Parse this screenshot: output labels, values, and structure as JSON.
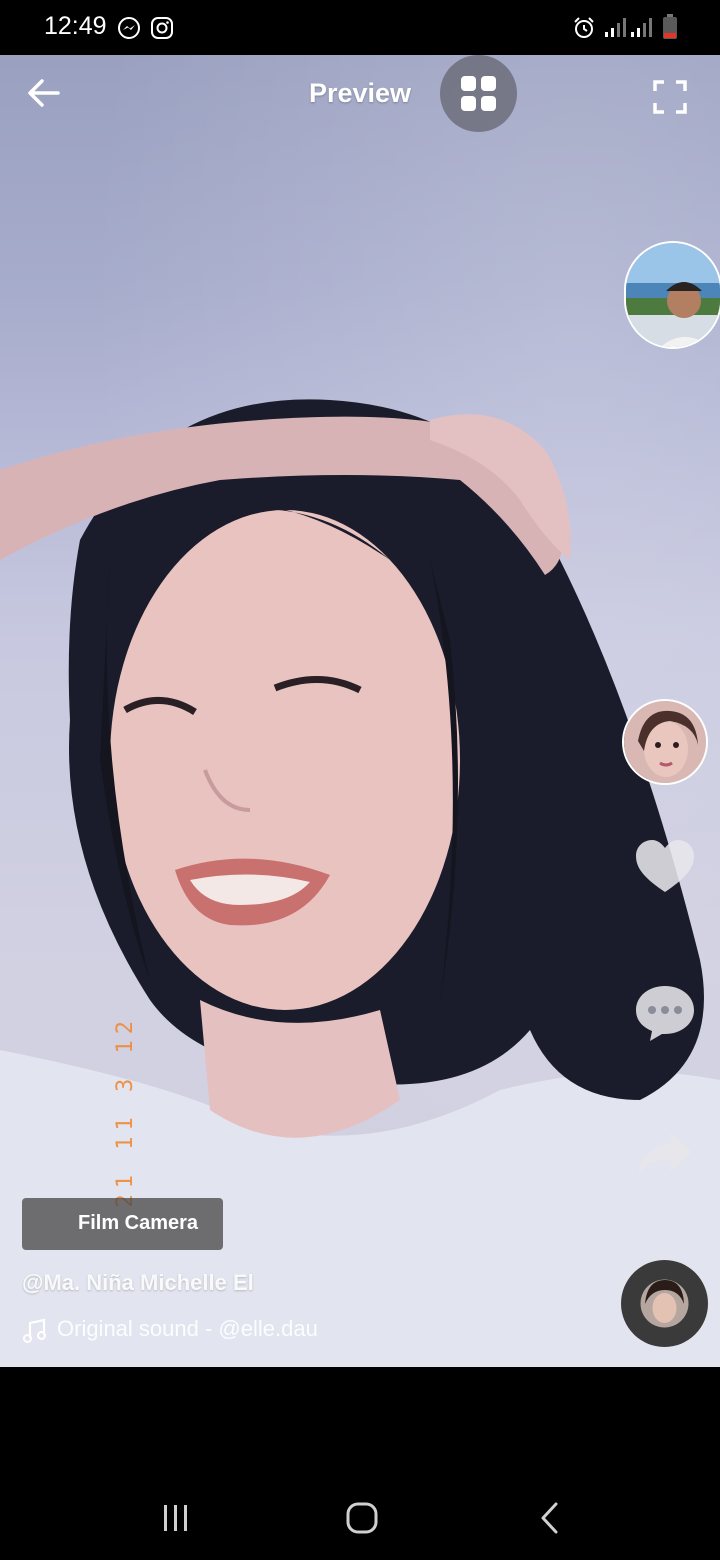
{
  "status_bar": {
    "time": "12:49",
    "icons": [
      "messenger-icon",
      "instagram-icon",
      "alarm-icon",
      "signal-icon",
      "signal-icon",
      "battery-low-icon"
    ]
  },
  "header": {
    "title": "Preview",
    "icons": [
      "back-arrow-icon",
      "grid-icon",
      "fullscreen-icon"
    ]
  },
  "right_rail": {
    "items": [
      "profile-avatar",
      "effect-avatar",
      "heart-icon",
      "comment-icon",
      "share-icon",
      "sound-disc-avatar"
    ]
  },
  "effect": {
    "label": "Film Camera"
  },
  "post": {
    "username": "@Ma. Niña Michelle El",
    "sound": "Original sound - @elle.dau",
    "date_stamp": "21 11 3 12"
  },
  "colors": {
    "accent_timestamp": "#f08a35",
    "battery_low": "#e0352b"
  },
  "nav_bar": {
    "icons": [
      "recent-apps-icon",
      "home-icon",
      "back-icon"
    ]
  }
}
